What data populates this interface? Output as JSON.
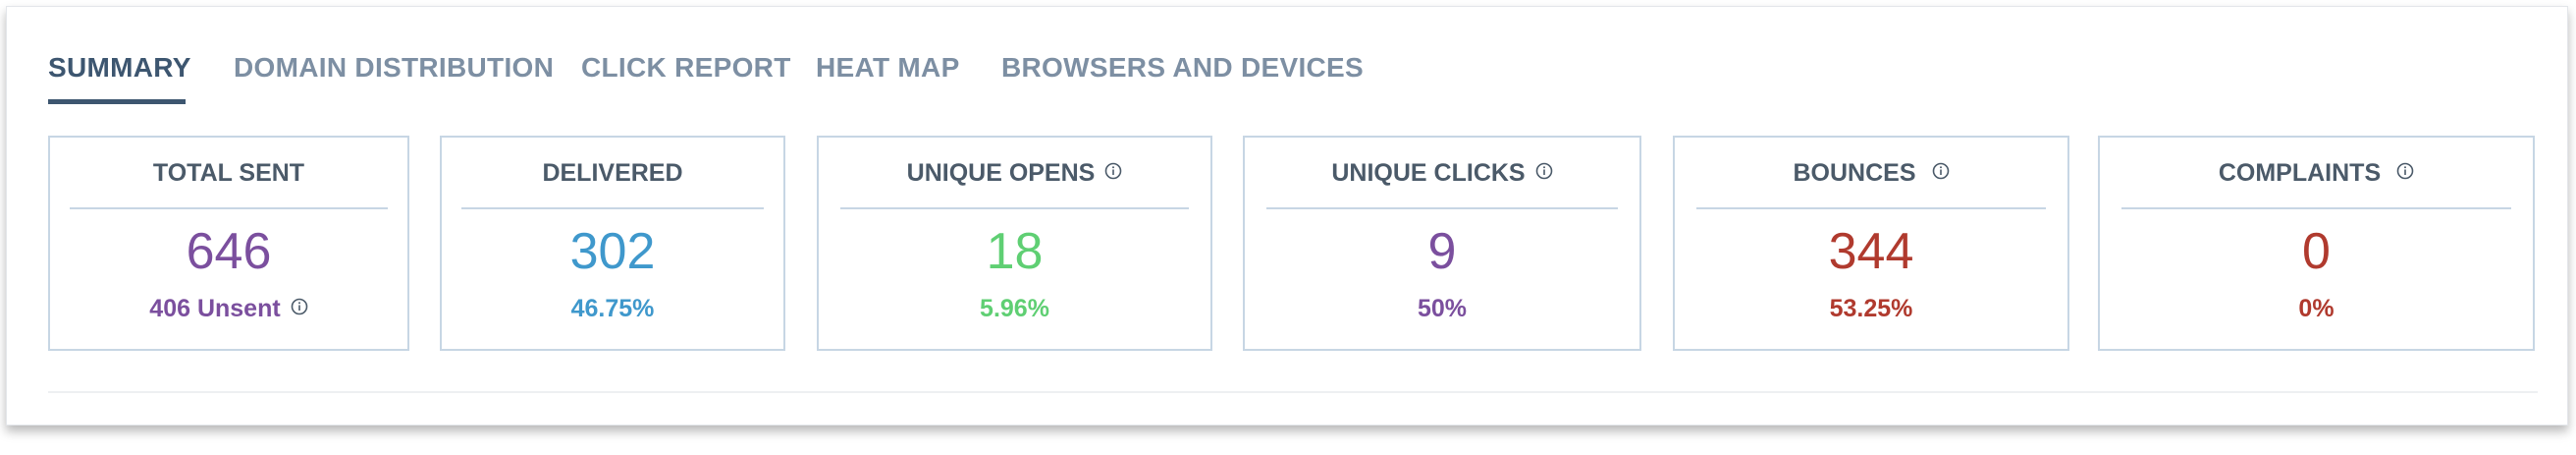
{
  "tabs": [
    {
      "label": "SUMMARY",
      "active": true
    },
    {
      "label": "DOMAIN DISTRIBUTION",
      "active": false
    },
    {
      "label": "CLICK REPORT",
      "active": false
    },
    {
      "label": "HEAT MAP",
      "active": false
    },
    {
      "label": "BROWSERS AND DEVICES",
      "active": false
    }
  ],
  "cards": {
    "total_sent": {
      "title": "TOTAL SENT",
      "value": "646",
      "sub": "406 Unsent",
      "color": "#7b4f9e"
    },
    "delivered": {
      "title": "DELIVERED",
      "value": "302",
      "sub": "46.75%",
      "color": "#3f98cc"
    },
    "unique_opens": {
      "title": "UNIQUE OPENS",
      "value": "18",
      "sub": "5.96%",
      "color": "#5fcf73"
    },
    "unique_clicks": {
      "title": "UNIQUE CLICKS",
      "value": "9",
      "sub": "50%",
      "color": "#7b4f9e"
    },
    "bounces": {
      "title": "BOUNCES",
      "value": "344",
      "sub": "53.25%",
      "color": "#b03a2e"
    },
    "complaints": {
      "title": "COMPLAINTS",
      "value": "0",
      "sub": "0%",
      "color": "#b03a2e"
    }
  },
  "icons": {
    "info": "info-circle-icon"
  },
  "colors": {
    "tab_active": "#3d5670",
    "tab_inactive": "#7d8fa3",
    "card_border": "#c7d6e4"
  }
}
